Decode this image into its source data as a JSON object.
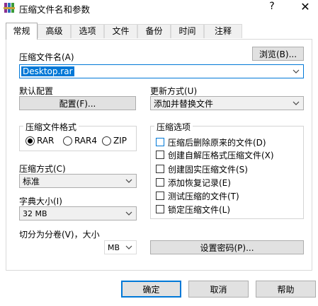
{
  "window": {
    "title": "压缩文件名和参数",
    "help_glyph": "?",
    "close_glyph": "✕"
  },
  "tabs": [
    "常规",
    "高级",
    "选项",
    "文件",
    "备份",
    "时间",
    "注释"
  ],
  "general": {
    "archive_name_label": "压缩文件名(A)",
    "archive_name_value": "Desktop.rar",
    "browse_button": "浏览(B)...",
    "default_profile_label": "默认配置",
    "profiles_button": "配置(F)...",
    "update_mode_label": "更新方式(U)",
    "update_mode_value": "添加并替换文件",
    "archive_format_group": "压缩文件格式",
    "formats": [
      "RAR",
      "RAR4",
      "ZIP"
    ],
    "selected_format": "RAR",
    "compression_method_label": "压缩方式(C)",
    "compression_method_value": "标准",
    "dictionary_size_label": "字典大小(I)",
    "dictionary_size_value": "32 MB",
    "split_volumes_label": "切分为分卷(V)，大小",
    "split_unit_value": "MB",
    "set_password_button": "设置密码(P)...",
    "archiving_options_group": "压缩选项",
    "options": [
      {
        "label": "压缩后删除原来的文件(D)",
        "checked": false
      },
      {
        "label": "创建自解压格式压缩文件(X)",
        "checked": false
      },
      {
        "label": "创建固实压缩文件(S)",
        "checked": false
      },
      {
        "label": "添加恢复记录(E)",
        "checked": false
      },
      {
        "label": "测试压缩的文件(T)",
        "checked": false
      },
      {
        "label": "锁定压缩文件(L)",
        "checked": false
      }
    ]
  },
  "footer": {
    "ok_button": "确定",
    "cancel_button": "取消",
    "help_button": "帮助"
  },
  "colors": {
    "accent": "#0078d7",
    "selection_bg": "#0078d7",
    "button_face": "#e1e1e1",
    "dialog_bg": "#f0f0f0"
  }
}
